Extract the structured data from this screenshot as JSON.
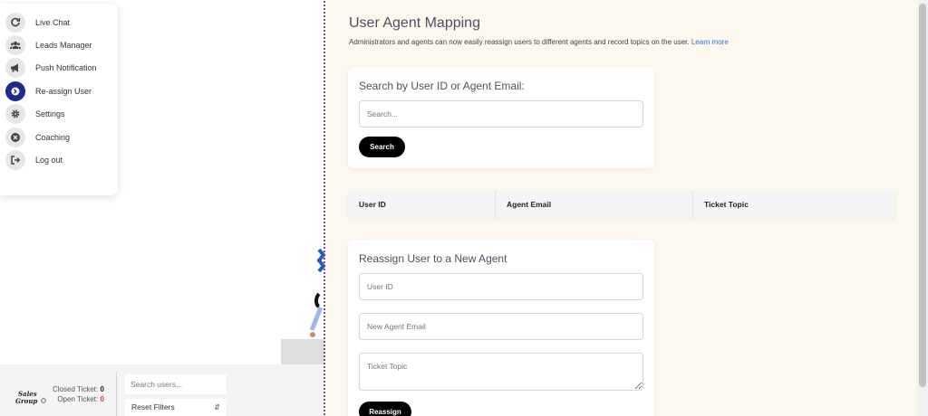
{
  "menu": {
    "items": [
      {
        "label": "Live Chat",
        "icon": "refresh-icon"
      },
      {
        "label": "Leads Manager",
        "icon": "users-icon"
      },
      {
        "label": "Push Notification",
        "icon": "megaphone-icon"
      },
      {
        "label": "Re-assign User",
        "icon": "arrow-right-icon",
        "active": true
      },
      {
        "label": "Settings",
        "icon": "gear-icon"
      },
      {
        "label": "Coaching",
        "icon": "cross-circle-icon"
      },
      {
        "label": "Log out",
        "icon": "logout-icon"
      }
    ]
  },
  "bottom": {
    "closed_label": "Closed Ticket:",
    "closed_value": "0",
    "open_label": "Open Ticket:",
    "open_value": "0",
    "search_placeholder": "Search users...",
    "reset_label": "Reset Filters"
  },
  "main": {
    "title": "User Agent Mapping",
    "subtitle": "Administrators and agents can now easily reassign users to different agents and record topics on the user.",
    "learn_more": "Learn more",
    "search_card": {
      "title": "Search by User ID or Agent Email:",
      "placeholder": "Search...",
      "button": "Search"
    },
    "table": {
      "columns": [
        "User ID",
        "Agent Email",
        "Ticket Topic"
      ]
    },
    "reassign_card": {
      "title": "Reassign User to a New Agent",
      "user_id_placeholder": "User ID",
      "agent_email_placeholder": "New Agent Email",
      "topic_placeholder": "Ticket Topic",
      "button": "Reassign"
    }
  },
  "colors": {
    "accent": "#1e2a8f",
    "link": "#2d6fd6",
    "panel_bg": "#fdf8ee",
    "open_ticket": "#d23b2a"
  }
}
